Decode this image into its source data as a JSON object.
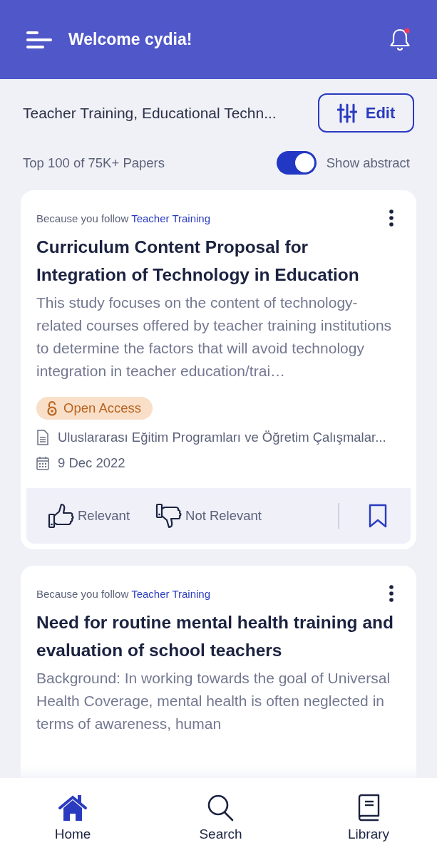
{
  "header": {
    "title": "Welcome cydia!",
    "has_notification": true
  },
  "filter": {
    "topics": "Teacher Training, Educational Techn...",
    "edit_label": "Edit"
  },
  "summary": {
    "count": "Top 100 of 75K+ Papers",
    "toggle_label": "Show abstract",
    "toggle_on": true
  },
  "papers": [
    {
      "reason": "Because you follow",
      "topic": "Teacher Training",
      "title": "Curriculum Content Proposal for Integration of Technology in Education",
      "abstract": "This study focuses on the content of technology-related courses offered by teacher training institutions to determine the factors that will avoid technology integration in teacher education/trai…",
      "open_access": "Open Access",
      "journal": "Uluslararası Eğitim Programları ve Öğretim Çalışmalar...",
      "date": "9 Dec 2022",
      "actions": [
        "Relevant",
        "Not Relevant"
      ],
      "bookmarked": false
    },
    {
      "reason": "Because you follow",
      "topic": "Teacher Training",
      "title": "Need for routine mental health training and evaluation of school teachers",
      "abstract": "Background:  In working towards the goal of Universal Health Coverage, mental health is often neglected in terms of awareness, human"
    }
  ],
  "nav": [
    {
      "label": "Home",
      "kind": "home",
      "selected": true
    },
    {
      "label": "Search",
      "kind": "search",
      "selected": false
    },
    {
      "label": "Library",
      "kind": "library",
      "selected": false
    }
  ]
}
